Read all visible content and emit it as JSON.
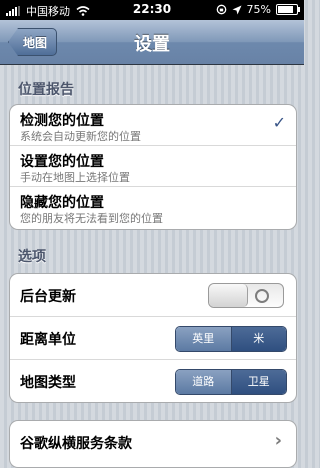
{
  "status_bar": {
    "carrier": "中国移动",
    "time": "22:30",
    "battery_percent": "75%",
    "battery_level": 0.75
  },
  "nav": {
    "back_label": "地图",
    "title": "设置"
  },
  "location": {
    "header": "位置报告",
    "items": [
      {
        "title": "检测您的位置",
        "subtitle": "系统会自动更新您的位置",
        "checked": true
      },
      {
        "title": "设置您的位置",
        "subtitle": "手动在地图上选择位置"
      },
      {
        "title": "隐藏您的位置",
        "subtitle": "您的朋友将无法看到您的位置"
      }
    ]
  },
  "options": {
    "header": "选项",
    "background_update": {
      "label": "后台更新",
      "state": "off"
    },
    "distance_unit": {
      "label": "距离单位",
      "options": [
        "英里",
        "米"
      ],
      "selected": "米"
    },
    "map_type": {
      "label": "地图类型",
      "options": [
        "道路",
        "卫星"
      ],
      "selected": "卫星"
    }
  },
  "terms": {
    "label": "谷歌纵横服务条款"
  }
}
